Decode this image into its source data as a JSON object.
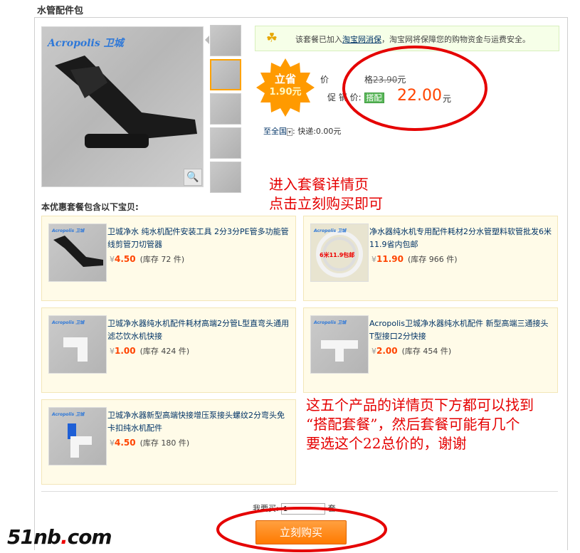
{
  "package_title": "水管配件包",
  "notice": {
    "pre": "该套餐已加入",
    "link": "淘宝网消保",
    "post": "，淘宝网将保障您的购物资金与运费安全。"
  },
  "savings_badge": {
    "label": "立省",
    "amount": "1.90元"
  },
  "price": {
    "label_a": "价",
    "label_b": "格",
    "original": "23.90",
    "unit": "元",
    "promo_label": "促 销 价:",
    "bundle_tag": "搭配",
    "promo_value": "22.00",
    "promo_unit": "元"
  },
  "shipping": {
    "region": "至全国",
    "dropdown": "▾",
    "text": ": 快递:0.00元"
  },
  "annotations": {
    "top_line1": "进入套餐详情页",
    "top_line2": "点击立刻购买即可",
    "bottom_line1": "这五个产品的详情页下方都可以找到",
    "bottom_line2": "“搭配套餐”，然后套餐可能有几个",
    "bottom_line3": "要选这个22总价的，谢谢"
  },
  "section_title": "本优惠套餐包含以下宝贝:",
  "products": [
    {
      "name": "卫城净水 纯水机配件安装工具 2分3分PE管多功能管线剪管刀切管器",
      "price": "4.50",
      "stock": "(库存 72 件)"
    },
    {
      "name": "净水器纯水机专用配件耗材2分水管塑料软管批发6米11.9省内包邮",
      "price": "11.90",
      "stock": "(库存 966 件)"
    },
    {
      "name": "卫城净水器纯水机配件耗材高端2分管L型直弯头通用滤芯饮水机快接",
      "price": "1.00",
      "stock": "(库存 424 件)"
    },
    {
      "name": "Acropolis卫城净水器纯水机配件 新型高端三通接头T型接口2分快接",
      "price": "2.00",
      "stock": "(库存 454 件)"
    },
    {
      "name": "卫城净水器新型高端快接增压泵接头螺纹2分弯头免卡扣纯水机配件",
      "price": "4.50",
      "stock": "(库存 180 件)"
    }
  ],
  "currency": "¥",
  "quantity": {
    "label": "我要买:",
    "value": "1",
    "unit": "套"
  },
  "buy_button": "立刻购买",
  "brand_text": "Acropolis 卫城",
  "image_product_label": "6米11.9包邮",
  "watermark": {
    "a": "51nb",
    "dot": ".",
    "b": "com"
  },
  "colors": {
    "accent": "#ff4400",
    "annotation": "#e50000",
    "link": "#003366",
    "button": "#ff7a00"
  }
}
